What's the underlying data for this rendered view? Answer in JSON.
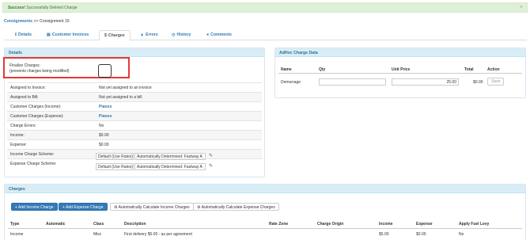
{
  "alert": {
    "strong": "Success!",
    "message": "Successfully Deleted Charge",
    "close": "×"
  },
  "breadcrumb": {
    "link": "Consignments",
    "sep": ">>",
    "current": "Consignment 15"
  },
  "tabs": [
    {
      "icon": "ℹ",
      "label": "Details"
    },
    {
      "icon": "▤",
      "label": "Customer Invoices"
    },
    {
      "icon": "$",
      "label": "Charges"
    },
    {
      "icon": "▲",
      "label": "Errors"
    },
    {
      "icon": "◷",
      "label": "History"
    },
    {
      "icon": "●",
      "label": "Comments"
    }
  ],
  "details": {
    "title": "Details",
    "finalize_label": "Finalize Charges:",
    "finalize_note": "(prevents charges being modified)",
    "rows": [
      {
        "label": "Assigned to Invoice:",
        "value": "Not yet assigned to an invoice"
      },
      {
        "label": "Assigned to Bill:",
        "value": "Not yet assigned to a bill"
      },
      {
        "label": "Customer Charges (Income):",
        "value": "Pianos"
      },
      {
        "label": "Customer Charges (Expense):",
        "value": "Pianos"
      },
      {
        "label": "Charge Errors:",
        "value": "No"
      },
      {
        "label": "Income:",
        "value": "$0.00"
      },
      {
        "label": "Expense:",
        "value": "$0.00"
      }
    ],
    "income_scheme": {
      "label": "Income Charge Scheme:",
      "a": "Default (Use Rates)",
      "b": "Automatically Determined: Fastway A"
    },
    "expense_scheme": {
      "label": "Expense Charge Scheme:",
      "a": "Default (Use Rates)",
      "b": "Automatically Determined: Fastway A"
    }
  },
  "adhoc": {
    "title": "AdHoc Charge Data",
    "headers": [
      "Name",
      "Qty",
      "Unit Price",
      "Total",
      "Action"
    ],
    "row": {
      "name": "Demurrage",
      "qty": "",
      "unit_price": "25.00",
      "total": "$0.00",
      "action": "Save"
    }
  },
  "charges": {
    "title": "Charges",
    "buttons": [
      "+ Add Income Charge",
      "+ Add Expense Charge",
      "⚙ Automatically Calculate Income Charges",
      "⚙ Automatically Calculate Expense Charges"
    ],
    "headers": [
      "Type",
      "Automatic",
      "Class",
      "Description",
      "Rate Zone",
      "Charge Origin",
      "Income",
      "Expense",
      "Apply Fuel Levy"
    ],
    "rows": [
      {
        "type": "Income",
        "automatic": "",
        "class": "Misc",
        "description": "First delivery $5.00 - as per agreement",
        "rate_zone": "",
        "origin": "",
        "income": "$5.00",
        "expense": "$0.00",
        "fuel": "No"
      }
    ]
  }
}
